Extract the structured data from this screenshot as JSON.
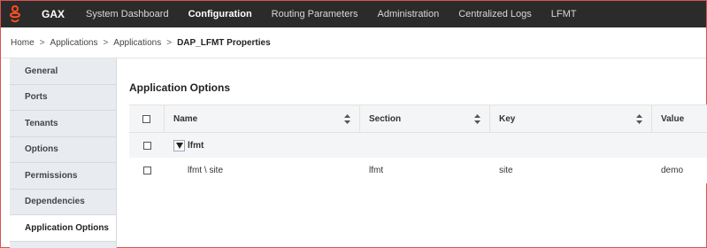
{
  "topbar": {
    "brand": "GAX",
    "nav": [
      {
        "label": "System Dashboard"
      },
      {
        "label": "Configuration"
      },
      {
        "label": "Routing Parameters"
      },
      {
        "label": "Administration"
      },
      {
        "label": "Centralized Logs"
      },
      {
        "label": "LFMT"
      }
    ],
    "active_index": 1
  },
  "breadcrumb": {
    "items": [
      "Home",
      "Applications",
      "Applications"
    ],
    "current": "DAP_LFMT Properties",
    "separator": ">"
  },
  "sidebar": {
    "items": [
      {
        "label": "General"
      },
      {
        "label": "Ports"
      },
      {
        "label": "Tenants"
      },
      {
        "label": "Options"
      },
      {
        "label": "Permissions"
      },
      {
        "label": "Dependencies"
      },
      {
        "label": "Application Options"
      }
    ],
    "active_index": 6
  },
  "main": {
    "title": "Application Options",
    "columns": {
      "name": "Name",
      "section": "Section",
      "key": "Key",
      "value": "Value"
    },
    "group": {
      "label": "lfmt",
      "expanded": true
    },
    "rows": [
      {
        "name": "lfmt \\ site",
        "section": "lfmt",
        "key": "site",
        "value": "demo"
      }
    ]
  },
  "colors": {
    "topbar_bg": "#2b2b2b",
    "brand_accent": "#ff4f1f",
    "sidebar_bg": "#e8ecf0",
    "grid_header_bg": "#f4f5f7"
  }
}
